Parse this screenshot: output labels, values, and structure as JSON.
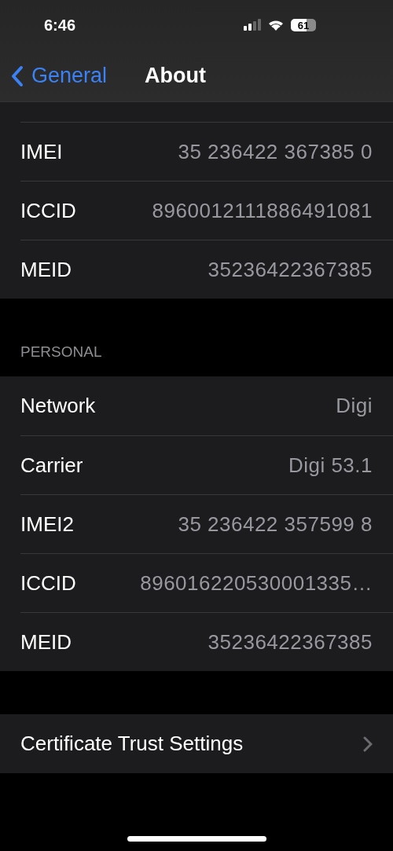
{
  "status_bar": {
    "time": "6:46",
    "battery": "61"
  },
  "nav": {
    "back": "General",
    "title": "About"
  },
  "groups": [
    {
      "rows": [
        {
          "label": "IMEI",
          "value": "35 236422 367385 0"
        },
        {
          "label": "ICCID",
          "value": "8960012111886491081"
        },
        {
          "label": "MEID",
          "value": "35236422367385"
        }
      ]
    },
    {
      "header": "PERSONAL",
      "rows": [
        {
          "label": "Network",
          "value": "Digi"
        },
        {
          "label": "Carrier",
          "value": "Digi 53.1"
        },
        {
          "label": "IMEI2",
          "value": "35 236422 357599 8"
        },
        {
          "label": "ICCID",
          "value": "896016220530001335…"
        },
        {
          "label": "MEID",
          "value": "35236422367385"
        }
      ]
    },
    {
      "rows": [
        {
          "label": "Certificate Trust Settings",
          "kind": "link"
        }
      ]
    }
  ]
}
